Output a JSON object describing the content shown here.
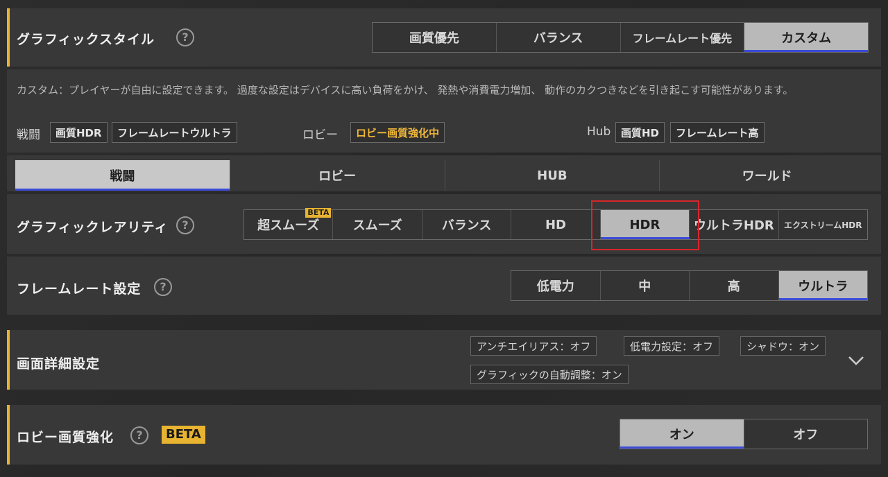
{
  "graphic_style": {
    "label": "グラフィックスタイル",
    "help": "?",
    "options": [
      "画質優先",
      "バランス",
      "フレームレート優先",
      "カスタム"
    ],
    "selected": "カスタム",
    "description": "カスタム：プレイヤーが自由に設定できます。 過度な設定はデバイスに高い負荷をかけ、 発熱や消費電力増加、 動作のカクつきなどを引き起こす可能性があります。",
    "summary": {
      "battle_label": "戦闘",
      "battle_tags": [
        "画質HDR",
        "フレームレートウルトラ"
      ],
      "lobby_label": "ロビー",
      "lobby_tag": "ロビー画質強化中",
      "hub_label": "Hub",
      "hub_tags": [
        "画質HD",
        "フレームレート高"
      ]
    }
  },
  "mode_tabs": {
    "items": [
      "戦闘",
      "ロビー",
      "HUB",
      "ワールド"
    ],
    "selected": "戦闘"
  },
  "graphics_rarity": {
    "label": "グラフィックレアリティ",
    "help": "?",
    "options": [
      "超スムーズ",
      "スムーズ",
      "バランス",
      "HD",
      "HDR",
      "ウルトラHDR",
      "エクストリームHDR"
    ],
    "beta_badge": "BETA",
    "selected": "HDR"
  },
  "frame_rate": {
    "label": "フレームレート設定",
    "help": "?",
    "options": [
      "低電力",
      "中",
      "高",
      "ウルトラ"
    ],
    "selected": "ウルトラ"
  },
  "screen_details": {
    "label": "画面詳細設定",
    "chips": [
      "アンチエイリアス：オフ",
      "低電力設定：オフ",
      "シャドウ：オン",
      "グラフィックの自動調整：オン"
    ]
  },
  "lobby_quality": {
    "label": "ロビー画質強化",
    "help": "?",
    "beta_badge": "BETA",
    "options": [
      "オン",
      "オフ"
    ],
    "selected": "オン"
  },
  "colors": {
    "accent": "#e8b330",
    "selected_bg": "#b9b9b9",
    "selected_underline": "#3b4bd8",
    "highlight_border": "#d8262a"
  }
}
